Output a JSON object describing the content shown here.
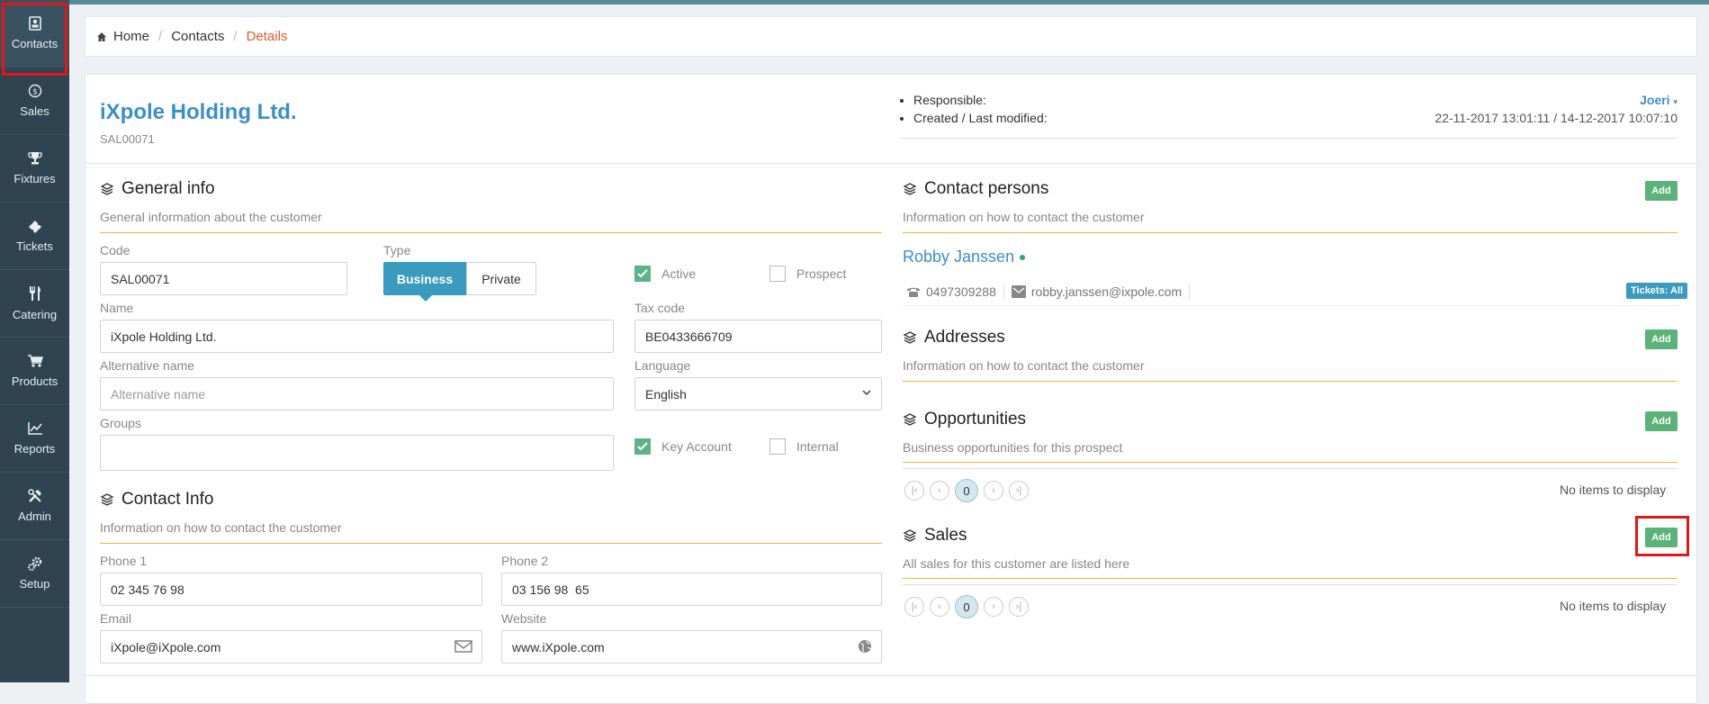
{
  "sidebar": {
    "items": [
      {
        "label": "Contacts",
        "icon": "contact-card-icon"
      },
      {
        "label": "Sales",
        "icon": "dollar-coin-icon"
      },
      {
        "label": "Fixtures",
        "icon": "trophy-icon"
      },
      {
        "label": "Tickets",
        "icon": "ticket-icon"
      },
      {
        "label": "Catering",
        "icon": "cutlery-icon"
      },
      {
        "label": "Products",
        "icon": "cart-icon"
      },
      {
        "label": "Reports",
        "icon": "line-chart-icon"
      },
      {
        "label": "Admin",
        "icon": "tools-icon"
      },
      {
        "label": "Setup",
        "icon": "gears-icon"
      }
    ]
  },
  "breadcrumb": {
    "home": "Home",
    "contacts": "Contacts",
    "current": "Details"
  },
  "company": {
    "name": "iXpole Holding Ltd.",
    "code": "SAL00071"
  },
  "meta": {
    "responsible_label": "Responsible:",
    "responsible_value": "Joeri",
    "created_label": "Created / Last modified:",
    "created_value": "22-11-2017 13:01:11 / 14-12-2017 10:07:10"
  },
  "general": {
    "title": "General info",
    "subtitle": "General information about the customer",
    "code_label": "Code",
    "code_value": "SAL00071",
    "type_label": "Type",
    "type_business": "Business",
    "type_private": "Private",
    "active_label": "Active",
    "prospect_label": "Prospect",
    "name_label": "Name",
    "name_value": "iXpole Holding Ltd.",
    "tax_label": "Tax code",
    "tax_value": "BE0433666709",
    "altname_label": "Alternative name",
    "altname_placeholder": "Alternative name",
    "language_label": "Language",
    "language_value": "English",
    "groups_label": "Groups",
    "key_account_label": "Key Account",
    "internal_label": "Internal"
  },
  "contact_info": {
    "title": "Contact Info",
    "subtitle": "Information on how to contact the customer",
    "phone1_label": "Phone 1",
    "phone1_value": "02 345 76 98",
    "phone2_label": "Phone 2",
    "phone2_value": "03 156 98  65",
    "email_label": "Email",
    "email_value": "iXpole@iXpole.com",
    "website_label": "Website",
    "website_value": "www.iXpole.com"
  },
  "contact_persons": {
    "title": "Contact persons",
    "subtitle": "Information on how to contact the customer",
    "add": "Add",
    "person_name": "Robby Janssen",
    "person_phone": "0497309288",
    "person_email": "robby.janssen@ixpole.com",
    "tickets_badge": "Tickets: All"
  },
  "addresses": {
    "title": "Addresses",
    "subtitle": "Information on how to contact the customer",
    "add": "Add"
  },
  "opportunities": {
    "title": "Opportunities",
    "subtitle": "Business opportunities for this prospect",
    "add": "Add",
    "page": "0",
    "empty": "No items to display"
  },
  "sales": {
    "title": "Sales",
    "subtitle": "All sales for this customer are listed here",
    "add": "Add",
    "page": "0",
    "empty": "No items to display"
  },
  "colors": {
    "sidebar": "#2f4350",
    "accent_blue": "#3a8fc8",
    "add_green": "#5cb37a",
    "section_rule": "#f0b43c",
    "highlight_red": "#e0161b"
  }
}
